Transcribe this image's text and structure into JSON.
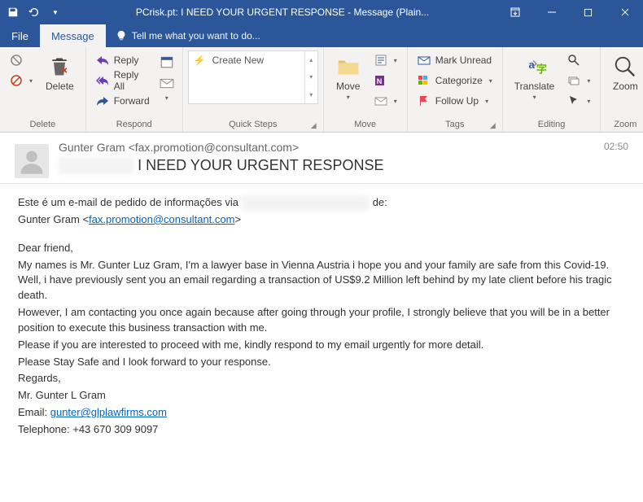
{
  "titlebar": {
    "title": "PCrisk.pt: I NEED YOUR URGENT RESPONSE - Message (Plain..."
  },
  "tabs": {
    "file": "File",
    "message": "Message",
    "tellme": "Tell me what you want to do..."
  },
  "ribbon": {
    "delete": {
      "label": "Delete",
      "group": "Delete"
    },
    "respond": {
      "reply": "Reply",
      "replyall": "Reply All",
      "forward": "Forward",
      "group": "Respond"
    },
    "quicksteps": {
      "create": "Create New",
      "group": "Quick Steps"
    },
    "move": {
      "label": "Move",
      "group": "Move"
    },
    "tags": {
      "unread": "Mark Unread",
      "categorize": "Categorize",
      "followup": "Follow Up",
      "group": "Tags"
    },
    "editing": {
      "translate": "Translate",
      "group": "Editing"
    },
    "zoom": {
      "label": "Zoom",
      "group": "Zoom"
    }
  },
  "header": {
    "from": "Gunter Gram <fax.promotion@consultant.com>",
    "subject": "I NEED YOUR URGENT RESPONSE",
    "time": "02:50"
  },
  "body": {
    "l1a": "Este é um e-mail de pedido de informações via ",
    "l1b": " de:",
    "l2a": "Gunter Gram <",
    "l2_email": "fax.promotion@consultant.com",
    "l2b": ">",
    "greeting": "Dear friend,",
    "p1": "My names is Mr. Gunter Luz Gram, I'm a lawyer base in Vienna Austria i hope you and your family are safe from this Covid-19. Well, i have previously sent you an email regarding a transaction of US$9.2 Million left behind by my late client before his tragic death.",
    "p2": "However, I am contacting you once again because after going through your profile, I strongly believe that you will be in a better position to execute this business transaction with me.",
    "p3": "Please if you are interested to proceed with me, kindly respond to my email urgently for more detail.",
    "p4": "Please Stay Safe and I look forward to your response.",
    "regards": "Regards,",
    "sig1": "Mr. Gunter L Gram",
    "sig2a": "Email: ",
    "sig2_email": "gunter@glplawfirms.com",
    "sig3": "Telephone: +43 670 309 9097"
  }
}
